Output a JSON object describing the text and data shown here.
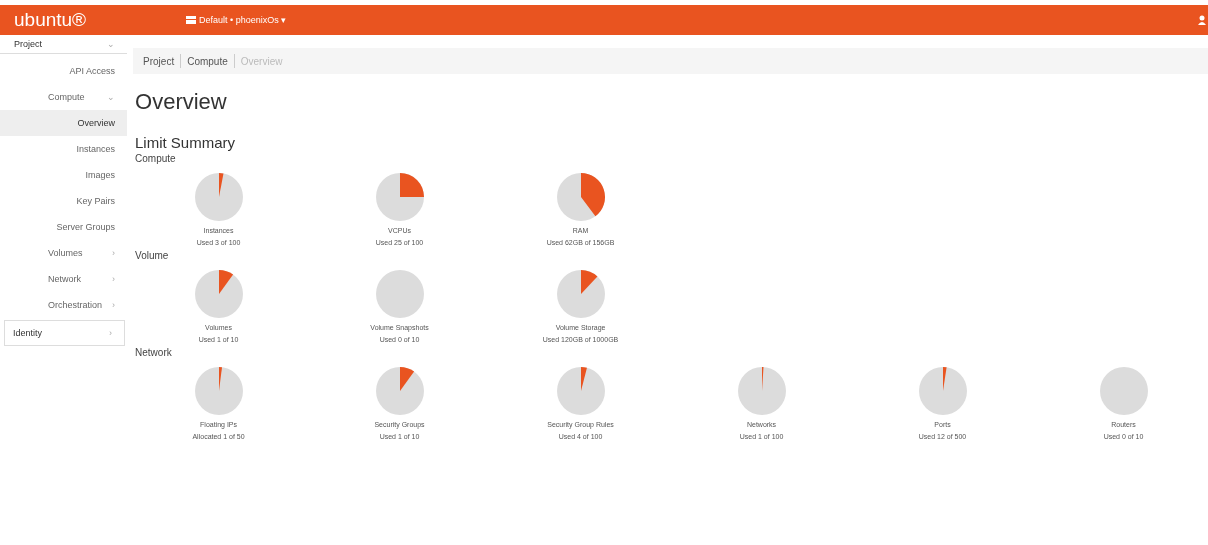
{
  "topbar": {
    "logo": "ubuntu®",
    "project_menu": "Default • phoenixOs ▾"
  },
  "sidebar": {
    "items": [
      {
        "label": "Project",
        "kind": "panel",
        "selected": false,
        "caret": "⌄"
      },
      {
        "label": "API Access",
        "kind": "item",
        "selected": false
      },
      {
        "label": "Compute",
        "kind": "group",
        "selected": false,
        "caret": "⌄"
      },
      {
        "label": "Overview",
        "kind": "item",
        "selected": true
      },
      {
        "label": "Instances",
        "kind": "item",
        "selected": false
      },
      {
        "label": "Images",
        "kind": "item",
        "selected": false
      },
      {
        "label": "Key Pairs",
        "kind": "item",
        "selected": false
      },
      {
        "label": "Server Groups",
        "kind": "item",
        "selected": false
      },
      {
        "label": "Volumes",
        "kind": "group",
        "selected": false,
        "caret": "›"
      },
      {
        "label": "Network",
        "kind": "group",
        "selected": false,
        "caret": "›"
      },
      {
        "label": "Orchestration",
        "kind": "group",
        "selected": false,
        "caret": "›"
      },
      {
        "label": "Identity",
        "kind": "panel-boxed",
        "selected": false,
        "caret": "›"
      }
    ]
  },
  "breadcrumb": [
    "Project",
    "Compute",
    "Overview"
  ],
  "title": "Overview",
  "limit_summary": {
    "heading": "Limit Summary",
    "sections": [
      {
        "name": "Compute",
        "gauges": [
          {
            "label": "Instances",
            "usage": "Used 3 of 100"
          },
          {
            "label": "VCPUs",
            "usage": "Used 25 of 100"
          },
          {
            "label": "RAM",
            "usage": "Used 62GB of 156GB"
          }
        ]
      },
      {
        "name": "Volume",
        "gauges": [
          {
            "label": "Volumes",
            "usage": "Used 1 of 10"
          },
          {
            "label": "Volume Snapshots",
            "usage": "Used 0 of 10"
          },
          {
            "label": "Volume Storage",
            "usage": "Used 120GB of 1000GB"
          }
        ]
      },
      {
        "name": "Network",
        "gauges": [
          {
            "label": "Floating IPs",
            "usage": "Allocated 1 of 50"
          },
          {
            "label": "Security Groups",
            "usage": "Used 1 of 10"
          },
          {
            "label": "Security Group Rules",
            "usage": "Used 4 of 100"
          },
          {
            "label": "Networks",
            "usage": "Used 1 of 100"
          },
          {
            "label": "Ports",
            "usage": "Used 12 of 500"
          },
          {
            "label": "Routers",
            "usage": "Used 0 of 10"
          }
        ]
      }
    ]
  }
}
